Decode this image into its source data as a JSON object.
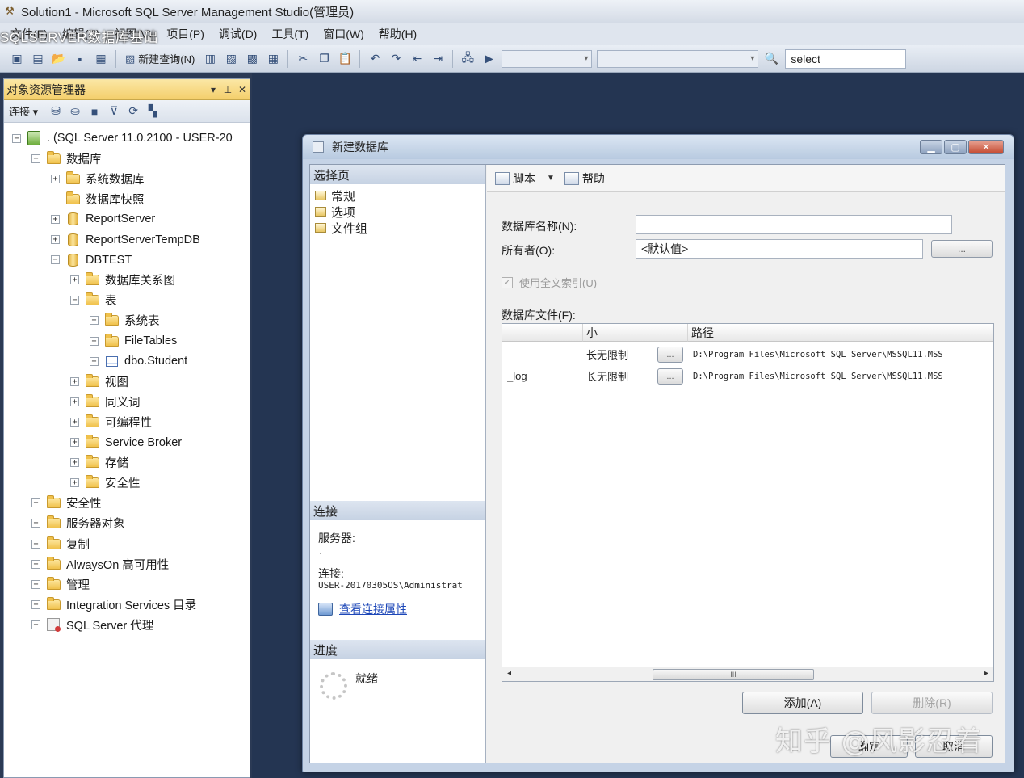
{
  "window": {
    "title": "Solution1 - Microsoft SQL Server Management Studio(管理员)"
  },
  "menubar": {
    "overlay_text": "SQLSERVER数据库基础",
    "items": [
      "文件(F)",
      "编辑(E)",
      "视图(V)",
      "项目(P)",
      "调试(D)",
      "工具(T)",
      "窗口(W)",
      "帮助(H)"
    ]
  },
  "toolbar": {
    "new_query": "新建查询(N)",
    "select_value": "select"
  },
  "object_explorer": {
    "title": "对象资源管理器",
    "connect_label": "连接 ▾",
    "tree": [
      {
        "label": ". (SQL Server 11.0.2100 - USER-20",
        "level": 0,
        "expander": "−",
        "icon": "server-icon"
      },
      {
        "label": "数据库",
        "level": 1,
        "expander": "−",
        "icon": "folder-icon"
      },
      {
        "label": "系统数据库",
        "level": 2,
        "expander": "+",
        "icon": "folder-icon"
      },
      {
        "label": "数据库快照",
        "level": 2,
        "expander": "",
        "icon": "folder-icon"
      },
      {
        "label": "ReportServer",
        "level": 2,
        "expander": "+",
        "icon": "database-icon"
      },
      {
        "label": "ReportServerTempDB",
        "level": 2,
        "expander": "+",
        "icon": "database-icon"
      },
      {
        "label": "DBTEST",
        "level": 2,
        "expander": "−",
        "icon": "database-icon"
      },
      {
        "label": "数据库关系图",
        "level": 3,
        "expander": "+",
        "icon": "folder-icon"
      },
      {
        "label": "表",
        "level": 3,
        "expander": "−",
        "icon": "folder-icon"
      },
      {
        "label": "系统表",
        "level": 4,
        "expander": "+",
        "icon": "folder-icon"
      },
      {
        "label": "FileTables",
        "level": 4,
        "expander": "+",
        "icon": "folder-icon"
      },
      {
        "label": "dbo.Student",
        "level": 4,
        "expander": "+",
        "icon": "table-icon"
      },
      {
        "label": "视图",
        "level": 3,
        "expander": "+",
        "icon": "folder-icon"
      },
      {
        "label": "同义词",
        "level": 3,
        "expander": "+",
        "icon": "folder-icon"
      },
      {
        "label": "可编程性",
        "level": 3,
        "expander": "+",
        "icon": "folder-icon"
      },
      {
        "label": "Service Broker",
        "level": 3,
        "expander": "+",
        "icon": "folder-icon"
      },
      {
        "label": "存储",
        "level": 3,
        "expander": "+",
        "icon": "folder-icon"
      },
      {
        "label": "安全性",
        "level": 3,
        "expander": "+",
        "icon": "folder-icon"
      },
      {
        "label": "安全性",
        "level": 1,
        "expander": "+",
        "icon": "folder-icon"
      },
      {
        "label": "服务器对象",
        "level": 1,
        "expander": "+",
        "icon": "folder-icon"
      },
      {
        "label": "复制",
        "level": 1,
        "expander": "+",
        "icon": "folder-icon"
      },
      {
        "label": "AlwaysOn 高可用性",
        "level": 1,
        "expander": "+",
        "icon": "folder-icon"
      },
      {
        "label": "管理",
        "level": 1,
        "expander": "+",
        "icon": "folder-icon"
      },
      {
        "label": "Integration Services 目录",
        "level": 1,
        "expander": "+",
        "icon": "folder-icon"
      },
      {
        "label": "SQL Server 代理",
        "level": 1,
        "expander": "+",
        "icon": "agent-icon"
      }
    ]
  },
  "dialog": {
    "title": "新建数据库",
    "select_page_header": "选择页",
    "pages": [
      "常规",
      "选项",
      "文件组"
    ],
    "connection_header": "连接",
    "server_label": "服务器:",
    "server_value": ".",
    "connection_label": "连接:",
    "connection_value": "USER-20170305OS\\Administrat",
    "view_connection_link": "查看连接属性",
    "progress_header": "进度",
    "progress_status": "就绪",
    "script_button": "脚本",
    "help_button": "帮助",
    "db_name_label": "数据库名称(N):",
    "db_name_value": "",
    "owner_label": "所有者(O):",
    "owner_value": "<默认值>",
    "dots_label": "...",
    "fulltext_label": "使用全文索引(U)",
    "db_files_label": "数据库文件(F):",
    "grid": {
      "col_size": "小",
      "col_path": "路径",
      "rows": [
        {
          "name": "",
          "growth": "长无限制",
          "path": "D:\\Program Files\\Microsoft SQL Server\\MSSQL11.MSS"
        },
        {
          "name": "_log",
          "growth": "长无限制",
          "path": "D:\\Program Files\\Microsoft SQL Server\\MSSQL11.MSS"
        }
      ],
      "scroll_thumb": "III"
    },
    "add_button": "添加(A)",
    "remove_button": "删除(R)",
    "ok_button": "确定",
    "cancel_button": "取消"
  },
  "watermark": "知乎 @风影忍着"
}
